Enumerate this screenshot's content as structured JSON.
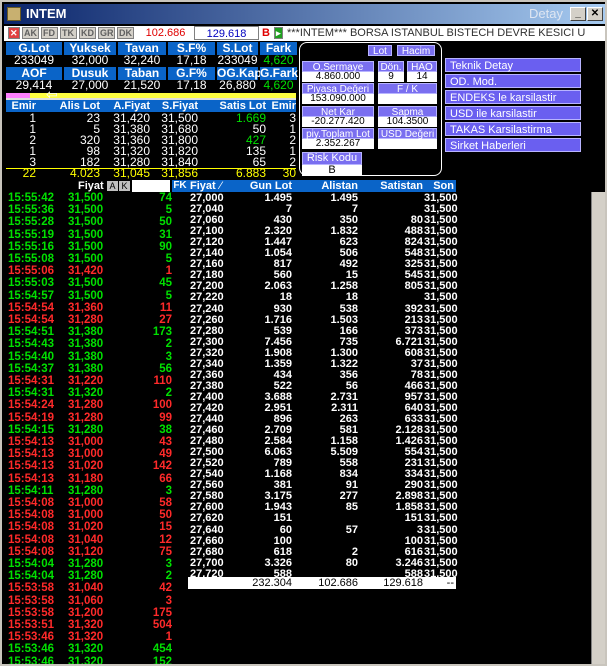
{
  "window": {
    "title": "INTEM",
    "right_title": "Detay"
  },
  "toolbar": {
    "buttons": [
      "AK",
      "FD",
      "TK",
      "KD",
      "GR",
      "DK"
    ],
    "value1": "102.686",
    "value2": "129.618",
    "ticker": "***INTEM*** BORSA ISTANBUL BISTECH DEVRE KESICI U",
    "flag_b": "B"
  },
  "summary": {
    "headers1": [
      "G.Lot",
      "Yuksek",
      "Tavan",
      "S.F%",
      "S.Lot",
      "Fark"
    ],
    "values1": [
      "233049",
      "32,000",
      "32,240",
      "17,18",
      "233049",
      "4,620"
    ],
    "headers2": [
      "AOF",
      "Dusuk",
      "Taban",
      "G.F%",
      "OG.Kap.",
      "G.Fark"
    ],
    "values2": [
      "29,414",
      "27,000",
      "21,520",
      "17,18",
      "26,880",
      "4,620"
    ]
  },
  "depth": {
    "headers": [
      "Emir",
      "Alis Lot",
      "A.Fiyat",
      "S.Fiyat",
      "Satis Lot",
      "Emir"
    ],
    "rows": [
      [
        "1",
        "23",
        "31,420",
        "31,500",
        "1.669",
        "3"
      ],
      [
        "1",
        "5",
        "31,380",
        "31,680",
        "50",
        "1"
      ],
      [
        "2",
        "320",
        "31,360",
        "31,800",
        "427",
        "2"
      ],
      [
        "1",
        "98",
        "31,320",
        "31,820",
        "135",
        "1"
      ],
      [
        "3",
        "182",
        "31,280",
        "31,840",
        "65",
        "2"
      ]
    ],
    "total": [
      "22",
      "4.023",
      "31,045",
      "31,856",
      "6.883",
      "30"
    ]
  },
  "popup": {
    "btn_lot": "Lot",
    "btn_hacim": "Hacim",
    "o_sermaye": "O.Sermaye",
    "o_sermaye_val": "4.860.000",
    "don": "Dön.",
    "don_val": "9",
    "hao": "HAO",
    "hao_val": "14",
    "piyasa": "Piyasa Değeri",
    "piyasa_val": "153.090.000",
    "fk": "F / K",
    "fk_val": "",
    "netkar": "Net Kar",
    "netkar_val": "-20.277.420",
    "sapma": "Sapma",
    "sapma_val": "104.3500",
    "piy_toplam": "piy.Toplam Lot",
    "piy_toplam_val": "2.352.267",
    "usd": "USD Değeri",
    "usd_val": "",
    "risk": "Risk Kodu",
    "risk_val": "B"
  },
  "menu": [
    "Teknik Detay",
    "OD. Mod.",
    "ENDEKS le karsilastir",
    "USD ile karsilastir",
    "TAKAS Karsilastirma",
    "Sirket Haberleri"
  ],
  "trades": {
    "headers": [
      "Fiyat",
      "A",
      "K",
      "FK"
    ],
    "rows": [
      [
        "15:55:42",
        "31,500",
        "74",
        "g"
      ],
      [
        "15:55:36",
        "31,500",
        "5",
        "g"
      ],
      [
        "15:55:28",
        "31,500",
        "50",
        "g"
      ],
      [
        "15:55:19",
        "31,500",
        "31",
        "g"
      ],
      [
        "15:55:16",
        "31,500",
        "90",
        "g"
      ],
      [
        "15:55:08",
        "31,500",
        "5",
        "g"
      ],
      [
        "15:55:06",
        "31,420",
        "1",
        "r"
      ],
      [
        "15:55:03",
        "31,500",
        "45",
        "g"
      ],
      [
        "15:54:57",
        "31,500",
        "5",
        "g"
      ],
      [
        "15:54:54",
        "31,360",
        "11",
        "r"
      ],
      [
        "15:54:54",
        "31,280",
        "27",
        "r"
      ],
      [
        "15:54:51",
        "31,380",
        "173",
        "g"
      ],
      [
        "15:54:43",
        "31,380",
        "2",
        "g"
      ],
      [
        "15:54:40",
        "31,380",
        "3",
        "g"
      ],
      [
        "15:54:37",
        "31,380",
        "56",
        "g"
      ],
      [
        "15:54:31",
        "31,220",
        "110",
        "r"
      ],
      [
        "15:54:31",
        "31,320",
        "2",
        "g"
      ],
      [
        "15:54:24",
        "31,280",
        "100",
        "r"
      ],
      [
        "15:54:19",
        "31,280",
        "99",
        "r"
      ],
      [
        "15:54:15",
        "31,280",
        "38",
        "g"
      ],
      [
        "15:54:13",
        "31,000",
        "43",
        "r"
      ],
      [
        "15:54:13",
        "31,000",
        "49",
        "r"
      ],
      [
        "15:54:13",
        "31,020",
        "142",
        "r"
      ],
      [
        "15:54:13",
        "31,180",
        "66",
        "r"
      ],
      [
        "15:54:11",
        "31,280",
        "3",
        "g"
      ],
      [
        "15:54:08",
        "31,000",
        "58",
        "r"
      ],
      [
        "15:54:08",
        "31,000",
        "50",
        "r"
      ],
      [
        "15:54:08",
        "31,020",
        "15",
        "r"
      ],
      [
        "15:54:08",
        "31,040",
        "12",
        "r"
      ],
      [
        "15:54:08",
        "31,120",
        "75",
        "r"
      ],
      [
        "15:54:04",
        "31,280",
        "3",
        "g"
      ],
      [
        "15:54:04",
        "31,280",
        "2",
        "g"
      ],
      [
        "15:53:58",
        "31,040",
        "42",
        "r"
      ],
      [
        "15:53:58",
        "31,060",
        "3",
        "r"
      ],
      [
        "15:53:58",
        "31,200",
        "175",
        "r"
      ],
      [
        "15:53:51",
        "31,320",
        "504",
        "r"
      ],
      [
        "15:53:46",
        "31,320",
        "1",
        "r"
      ],
      [
        "15:53:46",
        "31,320",
        "454",
        "g"
      ],
      [
        "15:53:46",
        "31,320",
        "152",
        "g"
      ]
    ]
  },
  "orderbook": {
    "headers": [
      "Fiyat",
      "Gun Lot",
      "Alistan",
      "Satistan",
      "Son"
    ],
    "rows": [
      [
        "27,000",
        "1.495",
        "1.495",
        "",
        "31,500"
      ],
      [
        "27,040",
        "7",
        "7",
        "",
        "31,500"
      ],
      [
        "27,060",
        "430",
        "350",
        "80",
        "31,500"
      ],
      [
        "27,100",
        "2.320",
        "1.832",
        "488",
        "31,500"
      ],
      [
        "27,120",
        "1.447",
        "623",
        "824",
        "31,500"
      ],
      [
        "27,140",
        "1.054",
        "506",
        "548",
        "31,500"
      ],
      [
        "27,160",
        "817",
        "492",
        "325",
        "31,500"
      ],
      [
        "27,180",
        "560",
        "15",
        "545",
        "31,500"
      ],
      [
        "27,200",
        "2.063",
        "1.258",
        "805",
        "31,500"
      ],
      [
        "27,220",
        "18",
        "18",
        "",
        "31,500"
      ],
      [
        "27,240",
        "930",
        "538",
        "392",
        "31,500"
      ],
      [
        "27,260",
        "1.716",
        "1.503",
        "213",
        "31,500"
      ],
      [
        "27,280",
        "539",
        "166",
        "373",
        "31,500"
      ],
      [
        "27,300",
        "7.456",
        "735",
        "6.721",
        "31,500"
      ],
      [
        "27,320",
        "1.908",
        "1.300",
        "608",
        "31,500"
      ],
      [
        "27,340",
        "1.359",
        "1.322",
        "37",
        "31,500"
      ],
      [
        "27,360",
        "434",
        "356",
        "78",
        "31,500"
      ],
      [
        "27,380",
        "522",
        "56",
        "466",
        "31,500"
      ],
      [
        "27,400",
        "3.688",
        "2.731",
        "957",
        "31,500"
      ],
      [
        "27,420",
        "2.951",
        "2.311",
        "640",
        "31,500"
      ],
      [
        "27,440",
        "896",
        "263",
        "633",
        "31,500"
      ],
      [
        "27,460",
        "2.709",
        "581",
        "2.128",
        "31,500"
      ],
      [
        "27,480",
        "2.584",
        "1.158",
        "1.426",
        "31,500"
      ],
      [
        "27,500",
        "6.063",
        "5.509",
        "554",
        "31,500"
      ],
      [
        "27,520",
        "789",
        "558",
        "231",
        "31,500"
      ],
      [
        "27,540",
        "1.168",
        "834",
        "334",
        "31,500"
      ],
      [
        "27,560",
        "381",
        "91",
        "290",
        "31,500"
      ],
      [
        "27,580",
        "3.175",
        "277",
        "2.898",
        "31,500"
      ],
      [
        "27,600",
        "1.943",
        "85",
        "1.858",
        "31,500"
      ],
      [
        "27,620",
        "151",
        "",
        "151",
        "31,500"
      ],
      [
        "27,640",
        "60",
        "57",
        "3",
        "31,500"
      ],
      [
        "27,660",
        "100",
        "",
        "100",
        "31,500"
      ],
      [
        "27,680",
        "618",
        "2",
        "616",
        "31,500"
      ],
      [
        "27,700",
        "3.326",
        "80",
        "3.246",
        "31,500"
      ],
      [
        "27,720",
        "588",
        "",
        "588",
        "31,500"
      ]
    ],
    "totals": [
      "232.304",
      "102.686",
      "129.618",
      "--"
    ]
  }
}
